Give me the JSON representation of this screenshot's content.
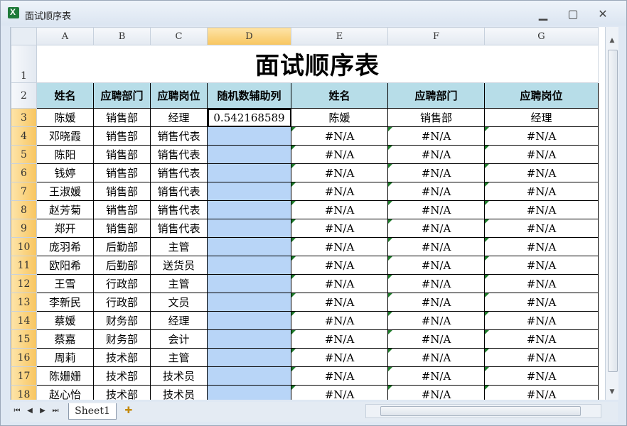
{
  "window": {
    "title": "面试顺序表",
    "min_glyph": "▁",
    "max_glyph": "▢",
    "close_glyph": "✕",
    "app_icon": "excel-icon"
  },
  "columns": [
    "A",
    "B",
    "C",
    "D",
    "E",
    "F",
    "G"
  ],
  "sheet_title": "面试顺序表",
  "headers": [
    "姓名",
    "应聘部门",
    "应聘岗位",
    "随机数辅助列",
    "姓名",
    "应聘部门",
    "应聘岗位"
  ],
  "row_numbers": [
    "1",
    "2",
    "3",
    "4",
    "5",
    "6",
    "7",
    "8",
    "9",
    "10",
    "11",
    "12",
    "13",
    "14",
    "15",
    "16",
    "17",
    "18"
  ],
  "rows": [
    [
      "陈媛",
      "销售部",
      "经理",
      "0.542168589",
      "陈媛",
      "销售部",
      "经理"
    ],
    [
      "邓晓霞",
      "销售部",
      "销售代表",
      "",
      "#N/A",
      "#N/A",
      "#N/A"
    ],
    [
      "陈阳",
      "销售部",
      "销售代表",
      "",
      "#N/A",
      "#N/A",
      "#N/A"
    ],
    [
      "钱婷",
      "销售部",
      "销售代表",
      "",
      "#N/A",
      "#N/A",
      "#N/A"
    ],
    [
      "王淑媛",
      "销售部",
      "销售代表",
      "",
      "#N/A",
      "#N/A",
      "#N/A"
    ],
    [
      "赵芳菊",
      "销售部",
      "销售代表",
      "",
      "#N/A",
      "#N/A",
      "#N/A"
    ],
    [
      "郑开",
      "销售部",
      "销售代表",
      "",
      "#N/A",
      "#N/A",
      "#N/A"
    ],
    [
      "庞羽希",
      "后勤部",
      "主管",
      "",
      "#N/A",
      "#N/A",
      "#N/A"
    ],
    [
      "欧阳希",
      "后勤部",
      "送货员",
      "",
      "#N/A",
      "#N/A",
      "#N/A"
    ],
    [
      "王雪",
      "行政部",
      "主管",
      "",
      "#N/A",
      "#N/A",
      "#N/A"
    ],
    [
      "李新民",
      "行政部",
      "文员",
      "",
      "#N/A",
      "#N/A",
      "#N/A"
    ],
    [
      "蔡媛",
      "财务部",
      "经理",
      "",
      "#N/A",
      "#N/A",
      "#N/A"
    ],
    [
      "蔡嘉",
      "财务部",
      "会计",
      "",
      "#N/A",
      "#N/A",
      "#N/A"
    ],
    [
      "周莉",
      "技术部",
      "主管",
      "",
      "#N/A",
      "#N/A",
      "#N/A"
    ],
    [
      "陈姗姗",
      "技术部",
      "技术员",
      "",
      "#N/A",
      "#N/A",
      "#N/A"
    ],
    [
      "赵心怡",
      "技术部",
      "技术员",
      "",
      "#N/A",
      "#N/A",
      "#N/A"
    ]
  ],
  "sheet_tabs": [
    "Sheet1"
  ],
  "selected_column": "D",
  "colors": {
    "header_fill": "#b7dde8",
    "selection_fill": "#b8d5f7",
    "selected_heading": "#f8c55f",
    "error_triangle": "#1e7b2a"
  }
}
